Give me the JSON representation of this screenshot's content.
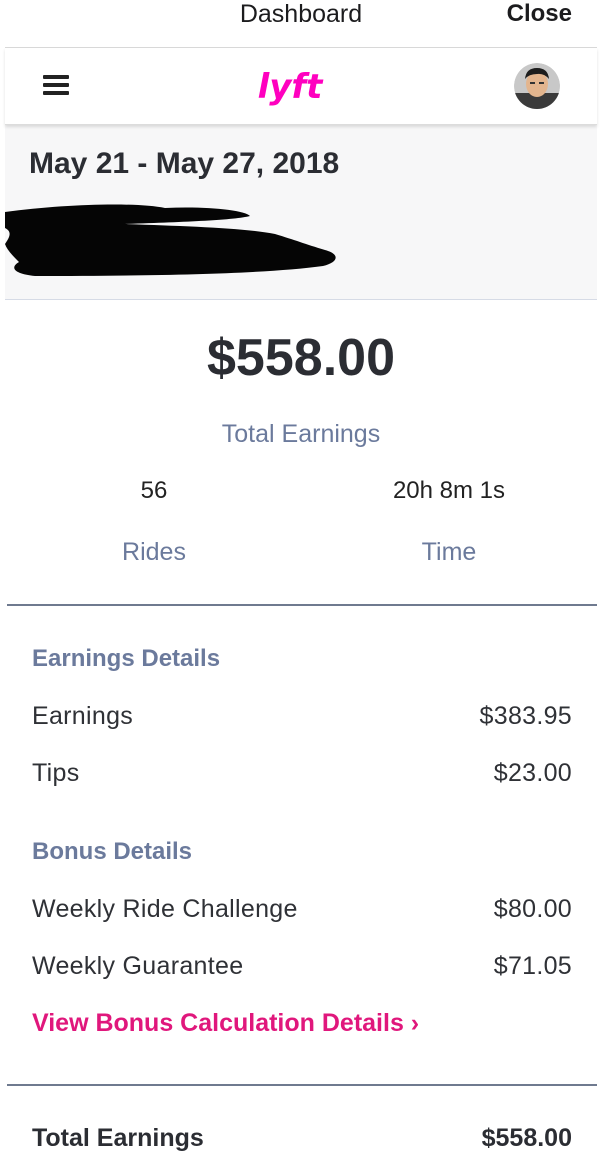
{
  "topbar": {
    "title": "Dashboard",
    "close_label": "Close"
  },
  "appbar": {
    "logo_text": "lyft",
    "brand_color": "#FF00BF"
  },
  "header": {
    "date_range": "May 21 - May 27, 2018"
  },
  "summary": {
    "total_amount": "$558.00",
    "total_label": "Total Earnings",
    "rides_value": "56",
    "rides_label": "Rides",
    "time_value": "20h 8m 1s",
    "time_label": "Time"
  },
  "earnings_details": {
    "heading": "Earnings Details",
    "rows": [
      {
        "label": "Earnings",
        "value": "$383.95"
      },
      {
        "label": "Tips",
        "value": "$23.00"
      }
    ]
  },
  "bonus_details": {
    "heading": "Bonus Details",
    "rows": [
      {
        "label": "Weekly Ride Challenge",
        "value": "$80.00"
      },
      {
        "label": "Weekly Guarantee",
        "value": "$71.05"
      }
    ],
    "link_label": "View Bonus Calculation Details ›"
  },
  "footer": {
    "label": "Total Earnings",
    "value": "$558.00"
  },
  "colors": {
    "accent": "#E0177C",
    "muted_label": "#6B7A9C",
    "divider": "#6F7A8F"
  }
}
